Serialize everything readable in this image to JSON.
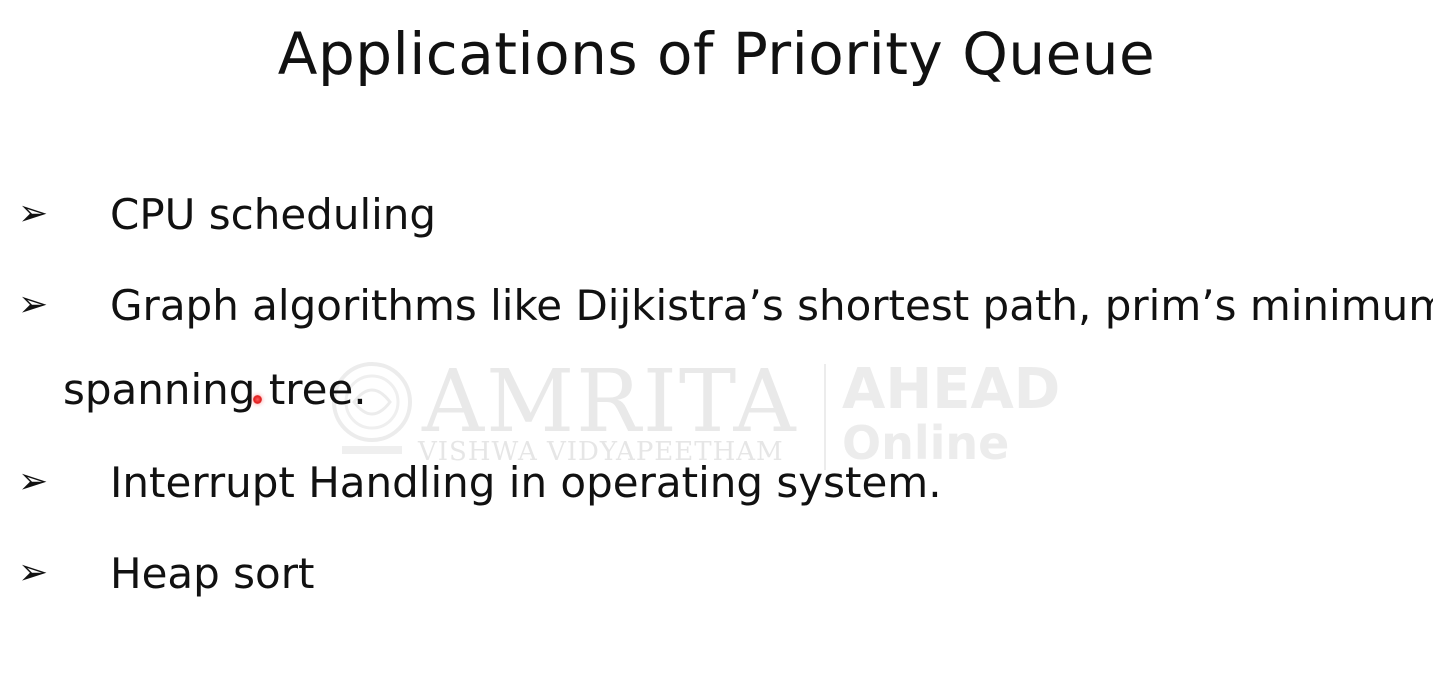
{
  "slide": {
    "title": "Applications of Priority Queue",
    "bullet_glyph": "➢",
    "bullets": [
      {
        "text": "CPU scheduling"
      },
      {
        "text": "Graph algorithms like Dijkistra’s shortest path, prim’s minimum",
        "continuation": "spanning tree."
      },
      {
        "text": "Interrupt Handling in operating system."
      },
      {
        "text": "Heap sort"
      }
    ]
  },
  "watermark": {
    "brand": "AMRITA",
    "subtitle": "VISHWA VIDYAPEETHAM",
    "partner": "AHEAD",
    "partner_sub": "Online"
  },
  "colors": {
    "text": "#111111",
    "watermark": "#e9e9e9",
    "pointer": "#e01e1e"
  }
}
